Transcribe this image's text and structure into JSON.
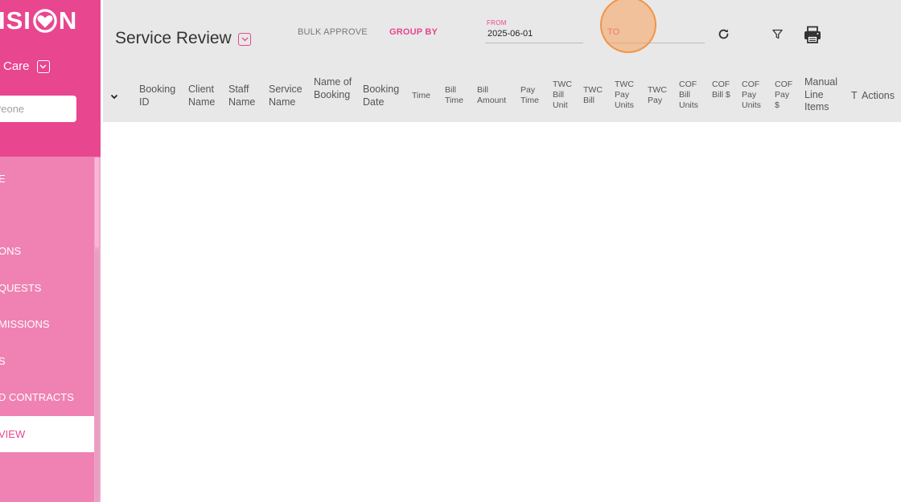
{
  "sidebar": {
    "logo_left": "ISI",
    "logo_right": "N",
    "org_name": "Care",
    "search_placeholder": "eone?",
    "items": [
      {
        "label": "E",
        "active": false
      },
      {
        "label": "ONS",
        "active": false
      },
      {
        "label": "QUESTS",
        "active": false
      },
      {
        "label": "MISSIONS",
        "active": false
      },
      {
        "label": "S",
        "active": false
      },
      {
        "label": "D CONTRACTS",
        "active": false
      },
      {
        "label": "VIEW",
        "active": true
      }
    ]
  },
  "header": {
    "title": "Service Review",
    "bulk_approve": "BULK APPROVE",
    "group_by": "GROUP BY",
    "from_label": "FROM",
    "from_value": "2025-06-01",
    "to_label": "TO"
  },
  "table": {
    "columns": [
      "Booking ID",
      "Client Name",
      "Staff Name",
      "Service Name",
      "Name of Booking",
      "Booking Date",
      "Time",
      "Bill Time",
      "Bill Amount",
      "Pay Time",
      "TWC Bill Unit",
      "TWC Bill",
      "TWC Pay Units",
      "TWC Pay",
      "COF Bill Units",
      "COF Bill $",
      "COF Pay Units",
      "COF Pay $",
      "Manual Line Items",
      "T",
      "Actions"
    ],
    "rows": []
  },
  "colors": {
    "brand_pink": "#e8468f",
    "sidebar_light": "#ef82b3",
    "header_gray": "#e8e8e8"
  },
  "icons": [
    "heart-icon",
    "chevron-down-icon",
    "refresh-icon",
    "filter-icon",
    "print-icon",
    "expand-icon"
  ]
}
